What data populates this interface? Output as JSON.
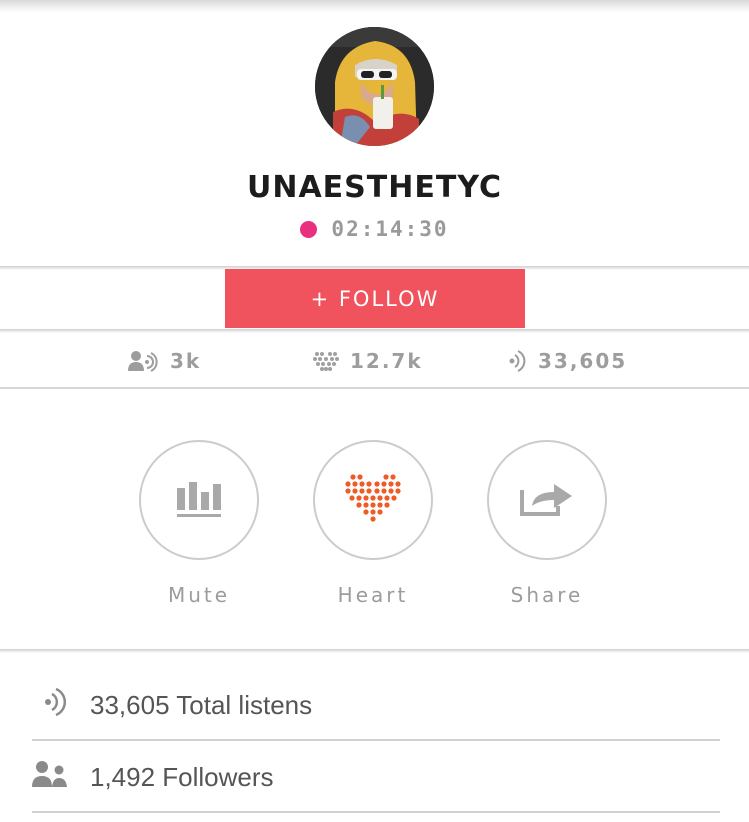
{
  "profile": {
    "username": "UNAESTHETYC",
    "live_time": "02:14:30",
    "live_color": "#e8307e"
  },
  "follow": {
    "label": "+ FOLLOW",
    "color": "#f0525e"
  },
  "stats": [
    {
      "icon": "listeners-icon",
      "value": "3k"
    },
    {
      "icon": "heart-icon",
      "value": "12.7k"
    },
    {
      "icon": "listens-icon",
      "value": "33,605"
    }
  ],
  "actions": [
    {
      "icon": "mute-icon",
      "label": "Mute"
    },
    {
      "icon": "heart-icon",
      "label": "Heart",
      "color": "#ef5b27"
    },
    {
      "icon": "share-icon",
      "label": "Share"
    }
  ],
  "info": [
    {
      "icon": "listens-icon",
      "text": "33,605 Total listens"
    },
    {
      "icon": "followers-icon",
      "text": "1,492 Followers"
    }
  ]
}
